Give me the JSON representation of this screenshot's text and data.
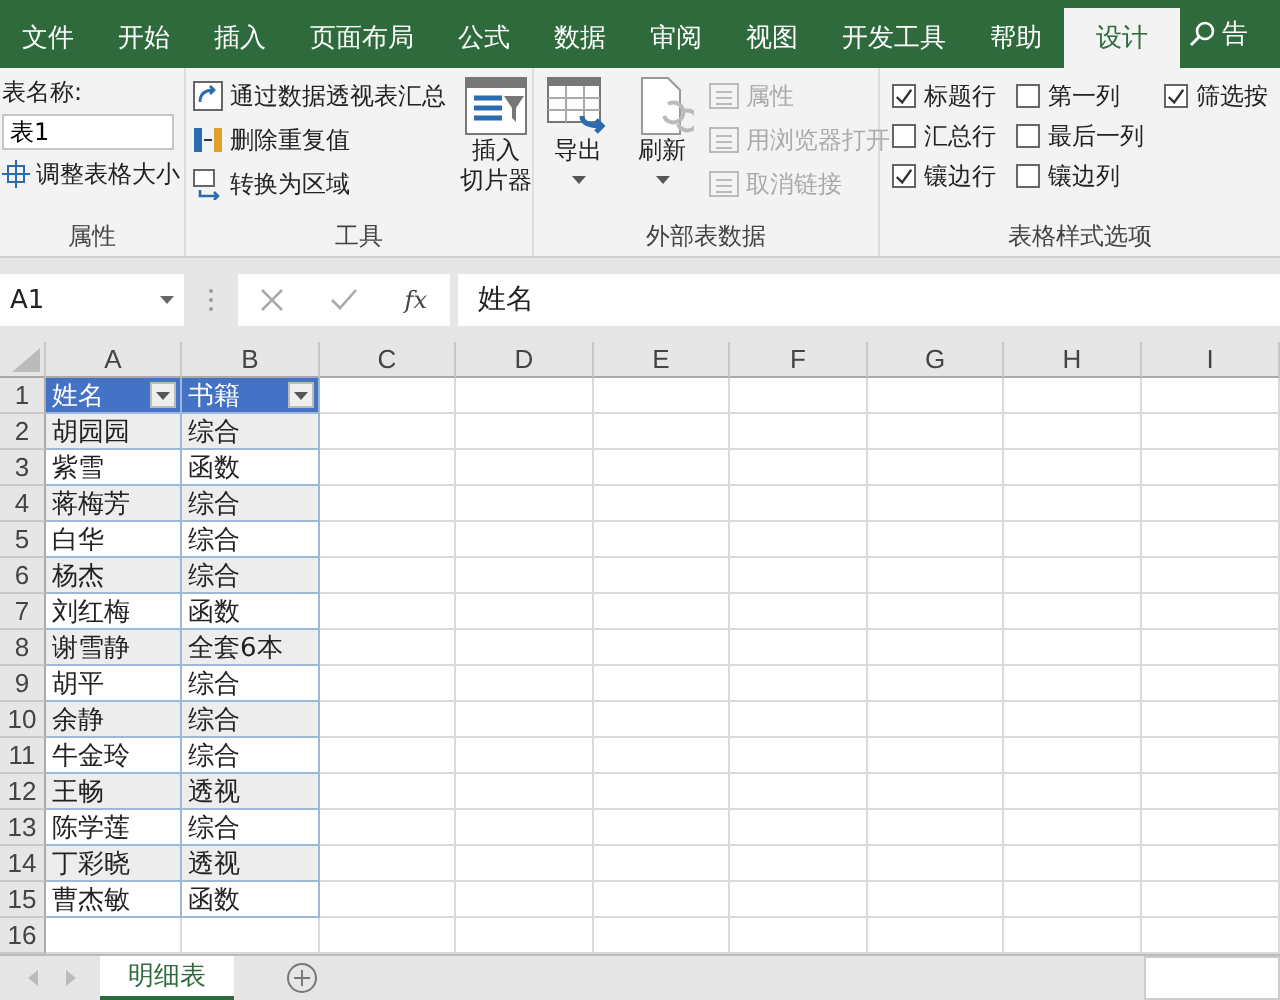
{
  "tabs": [
    {
      "label": "文件",
      "selected": false
    },
    {
      "label": "开始",
      "selected": false
    },
    {
      "label": "插入",
      "selected": false
    },
    {
      "label": "页面布局",
      "selected": false
    },
    {
      "label": "公式",
      "selected": false
    },
    {
      "label": "数据",
      "selected": false
    },
    {
      "label": "审阅",
      "selected": false
    },
    {
      "label": "视图",
      "selected": false
    },
    {
      "label": "开发工具",
      "selected": false
    },
    {
      "label": "帮助",
      "selected": false
    },
    {
      "label": "设计",
      "selected": true
    }
  ],
  "tell_me": {
    "label": "告"
  },
  "properties_group": {
    "title": "属性",
    "table_name_label": "表名称:",
    "table_name": "表1",
    "resize_button": "调整表格大小"
  },
  "tools_group": {
    "title": "工具",
    "buttons": [
      "通过数据透视表汇总",
      "删除重复值",
      "转换为区域"
    ],
    "slicer_button": [
      "插入",
      "切片器"
    ]
  },
  "external_data_group": {
    "title": "外部表数据",
    "export_button": "导出",
    "refresh_button": "刷新",
    "items": [
      {
        "label": "属性",
        "disabled": true
      },
      {
        "label": "用浏览器打开",
        "disabled": true
      },
      {
        "label": "取消链接",
        "disabled": true
      }
    ]
  },
  "style_options_group": {
    "title": "表格样式选项",
    "options": [
      {
        "label": "标题行",
        "checked": true
      },
      {
        "label": "汇总行",
        "checked": false
      },
      {
        "label": "镶边行",
        "checked": true
      },
      {
        "label": "第一列",
        "checked": false
      },
      {
        "label": "最后一列",
        "checked": false
      },
      {
        "label": "镶边列",
        "checked": false
      },
      {
        "label": "筛选按",
        "checked": true
      }
    ]
  },
  "formula_bar": {
    "name_box": "A1",
    "function_label": "fx",
    "formula": "姓名"
  },
  "columns": [
    "A",
    "B",
    "C",
    "D",
    "E",
    "F",
    "G",
    "H",
    "I"
  ],
  "row_numbers": [
    "1",
    "2",
    "3",
    "4",
    "5",
    "6",
    "7",
    "8",
    "9",
    "10",
    "11",
    "12",
    "13",
    "14",
    "15",
    "16"
  ],
  "table": {
    "headers": [
      "姓名",
      "书籍"
    ],
    "rows": [
      [
        "胡园园",
        "综合"
      ],
      [
        "紫雪",
        "函数"
      ],
      [
        "蒋梅芳",
        "综合"
      ],
      [
        "白华",
        "综合"
      ],
      [
        "杨杰",
        "综合"
      ],
      [
        "刘红梅",
        "函数"
      ],
      [
        "谢雪静",
        "全套6本"
      ],
      [
        "胡平",
        "综合"
      ],
      [
        "余静",
        "综合"
      ],
      [
        "牛金玲",
        "综合"
      ],
      [
        "王畅",
        "透视"
      ],
      [
        "陈学莲",
        "综合"
      ],
      [
        "丁彩晓",
        "透视"
      ],
      [
        "曹杰敏",
        "函数"
      ]
    ]
  },
  "sheet_tabs": [
    {
      "label": "明细表",
      "selected": true
    }
  ]
}
